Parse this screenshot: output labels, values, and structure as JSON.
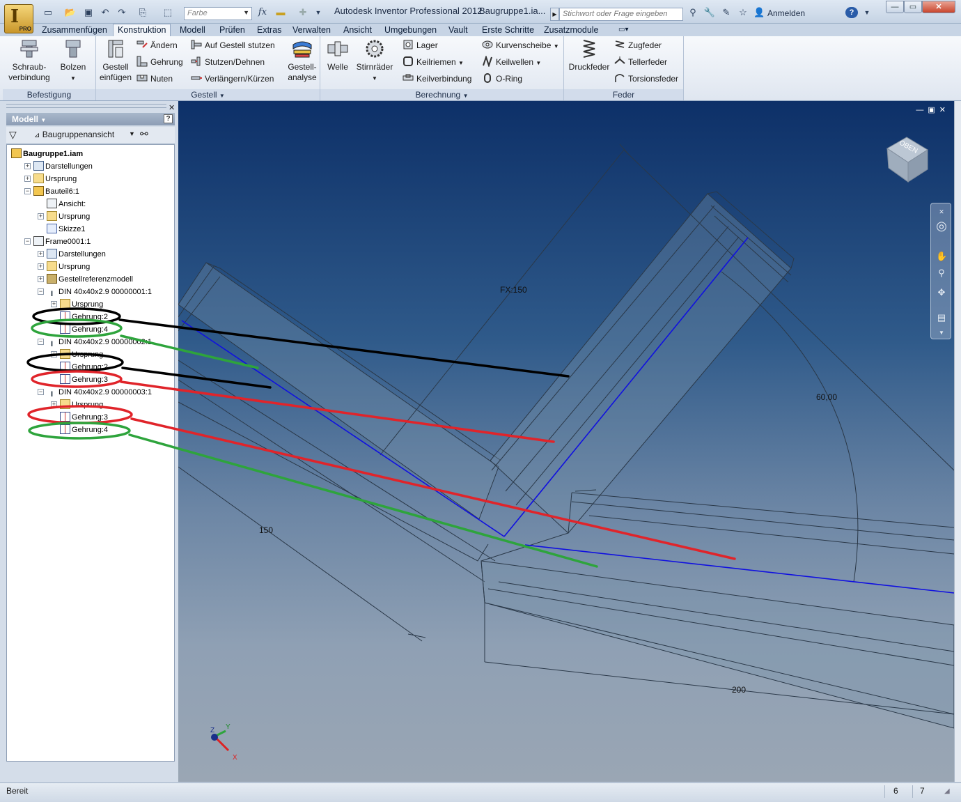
{
  "window": {
    "app_title": "Autodesk Inventor Professional 2012",
    "doc_title": "Baugruppe1.ia...",
    "app_badge": "PRO",
    "color_combo": "Farbe",
    "search_placeholder": "Stichwort oder Frage eingeben",
    "signin": "Anmelden",
    "help": "?"
  },
  "menu_tabs": [
    "Zusammenfügen",
    "Konstruktion",
    "Modell",
    "Prüfen",
    "Extras",
    "Verwalten",
    "Ansicht",
    "Umgebungen",
    "Vault",
    "Erste Schritte",
    "Zusatzmodule"
  ],
  "ribbon": {
    "befestigung": {
      "title": "Befestigung",
      "schraub_line1": "Schraub-",
      "schraub_line2": "verbindung",
      "bolzen": "Bolzen"
    },
    "gestell": {
      "title": "Gestell",
      "einfuegen_line1": "Gestell",
      "einfuegen_line2": "einfügen",
      "aendern": "Ändern",
      "gehrung": "Gehrung",
      "nuten": "Nuten",
      "auf_gestell": "Auf Gestell stutzen",
      "stutzen": "Stutzen/Dehnen",
      "verlaengern": "Verlängern/Kürzen",
      "analyse_line1": "Gestell-",
      "analyse_line2": "analyse"
    },
    "berechnung": {
      "title": "Berechnung",
      "welle": "Welle",
      "stirnraeder": "Stirnräder",
      "lager": "Lager",
      "keilriemen": "Keilriemen",
      "keilverbindung": "Keilverbindung",
      "kurvenscheibe": "Kurvenscheibe",
      "keilwellen": "Keilwellen",
      "oring": "O-Ring"
    },
    "feder": {
      "title": "Feder",
      "druckfeder": "Druckfeder",
      "zugfeder": "Zugfeder",
      "tellerfeder": "Tellerfeder",
      "torsionsfeder": "Torsionsfeder"
    }
  },
  "browser": {
    "title": "Modell",
    "view_mode": "Baugruppenansicht",
    "tree": [
      {
        "label": "Baugruppe1.iam",
        "depth": 0,
        "icon": "asm",
        "toggle": ""
      },
      {
        "label": "Darstellungen",
        "depth": 1,
        "icon": "view",
        "toggle": "+"
      },
      {
        "label": "Ursprung",
        "depth": 1,
        "icon": "folder",
        "toggle": "+"
      },
      {
        "label": "Bauteil6:1",
        "depth": 1,
        "icon": "asm",
        "toggle": "-"
      },
      {
        "label": "Ansicht:",
        "depth": 2,
        "icon": "frame",
        "toggle": ""
      },
      {
        "label": "Ursprung",
        "depth": 2,
        "icon": "folder",
        "toggle": "+"
      },
      {
        "label": "Skizze1",
        "depth": 2,
        "icon": "sketch",
        "toggle": ""
      },
      {
        "label": "Frame0001:1",
        "depth": 1,
        "icon": "frame",
        "toggle": "-"
      },
      {
        "label": "Darstellungen",
        "depth": 2,
        "icon": "view",
        "toggle": "+"
      },
      {
        "label": "Ursprung",
        "depth": 2,
        "icon": "folder",
        "toggle": "+"
      },
      {
        "label": "Gestellreferenzmodell",
        "depth": 2,
        "icon": "ref",
        "toggle": "+"
      },
      {
        "label": "DIN 40x40x2.9 00000001:1",
        "depth": 2,
        "icon": "beam",
        "toggle": "-"
      },
      {
        "label": "Ursprung",
        "depth": 3,
        "icon": "folder",
        "toggle": "+"
      },
      {
        "label": "Gehrung:2",
        "depth": 3,
        "icon": "miter",
        "toggle": ""
      },
      {
        "label": "Gehrung:4",
        "depth": 3,
        "icon": "miter",
        "toggle": ""
      },
      {
        "label": "DIN 40x40x2.9 00000002:1",
        "depth": 2,
        "icon": "beam",
        "toggle": "-"
      },
      {
        "label": "Ursprung",
        "depth": 3,
        "icon": "folder",
        "toggle": "+"
      },
      {
        "label": "Gehrung:2",
        "depth": 3,
        "icon": "miter",
        "toggle": ""
      },
      {
        "label": "Gehrung:3",
        "depth": 3,
        "icon": "miter",
        "toggle": ""
      },
      {
        "label": "DIN 40x40x2.9 00000003:1",
        "depth": 2,
        "icon": "beam",
        "toggle": "-"
      },
      {
        "label": "Ursprung",
        "depth": 3,
        "icon": "folder",
        "toggle": "+"
      },
      {
        "label": "Gehrung:3",
        "depth": 3,
        "icon": "miter",
        "toggle": ""
      },
      {
        "label": "Gehrung:4",
        "depth": 3,
        "icon": "miter",
        "toggle": ""
      }
    ]
  },
  "viewport": {
    "viewcube_label": "OBEN",
    "dimensions": {
      "fx": "FX:150",
      "angle": "60,00",
      "d150": "150",
      "d200": "200"
    },
    "axes": {
      "x": "X",
      "y": "Y",
      "z": "Z"
    }
  },
  "status": {
    "text": "Bereit",
    "n1": "6",
    "n2": "7"
  },
  "colors": {
    "annotation_black": "#000000",
    "annotation_green": "#2ea43c",
    "annotation_red": "#e0242a",
    "sketch_line": "#1010e0"
  }
}
